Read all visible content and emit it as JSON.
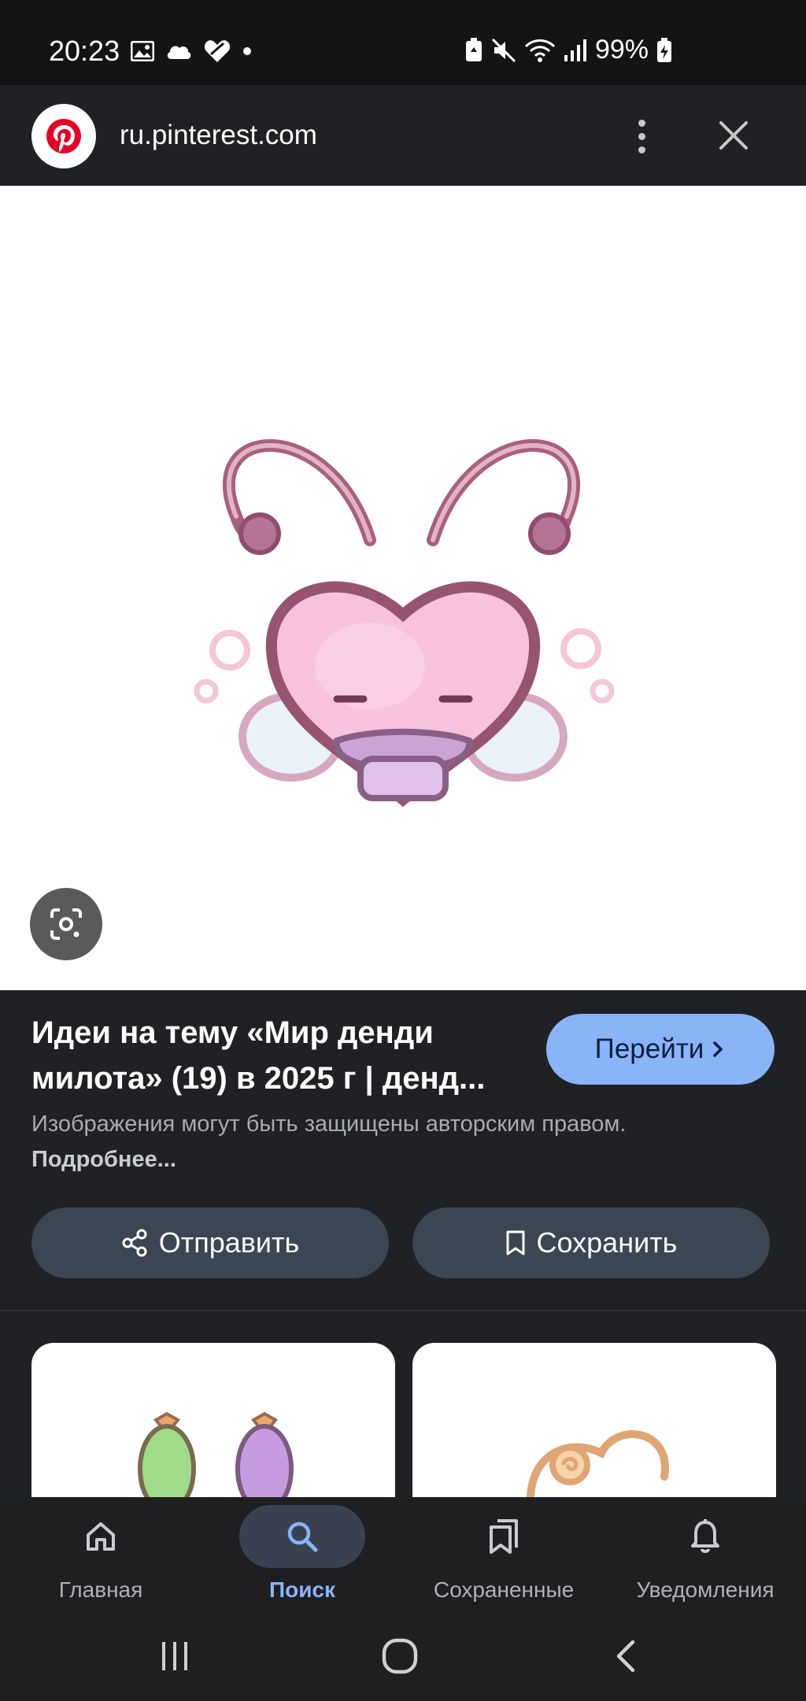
{
  "status_bar": {
    "time": "20:23",
    "battery": "99%",
    "icons_left": [
      "gallery-icon",
      "cloud-icon",
      "heart-icon",
      "dot-icon"
    ],
    "icons_right": [
      "battery-saver-icon",
      "mute-icon",
      "wifi-icon",
      "signal-icon",
      "battery-charging-icon"
    ]
  },
  "browser": {
    "url": "ru.pinterest.com",
    "favicon": "pinterest-icon"
  },
  "result": {
    "title": "Идеи на тему «Мир денди милота» (19) в 2025 г | денд...",
    "visit_label": "Перейти",
    "copyright_text": "Изображения могут быть защищены авторским правом.",
    "more_link": "Подробнее..."
  },
  "actions": {
    "share_label": "Отправить",
    "save_label": "Сохранить"
  },
  "bottom_nav": {
    "items": [
      {
        "label": "Главная",
        "icon": "home-icon"
      },
      {
        "label": "Поиск",
        "icon": "search-icon"
      },
      {
        "label": "Сохраненные",
        "icon": "saved-icon"
      },
      {
        "label": "Уведомления",
        "icon": "bell-icon"
      }
    ],
    "active": "Поиск"
  },
  "colors": {
    "background": "#202124",
    "accent": "#8ab4f8",
    "button": "#3c4552",
    "pinterest_red": "#e60023"
  }
}
